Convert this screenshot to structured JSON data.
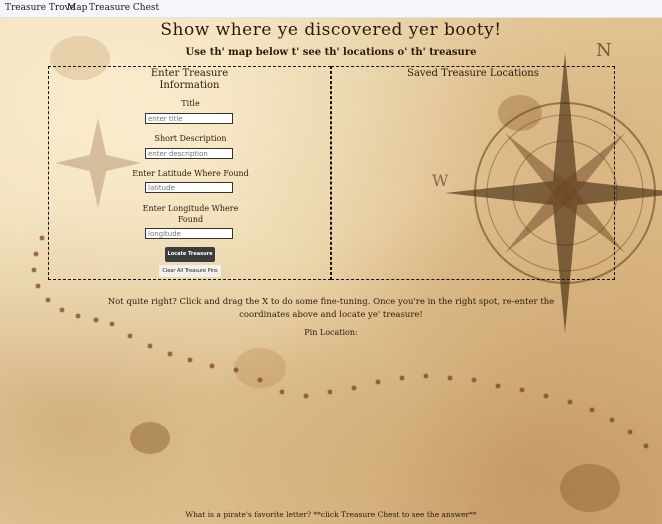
{
  "nav": {
    "brand": "Treasure Trove",
    "links": [
      "Map",
      "Treasure Chest"
    ]
  },
  "header": {
    "title": "Show where ye discovered yer booty!",
    "subtitle": "Use th' map below t' see th' locations o' th' treasure"
  },
  "form": {
    "heading": "Enter Treasure Information",
    "title_label": "Title",
    "title_placeholder": "enter title",
    "desc_label": "Short Description",
    "desc_placeholder": "enter description",
    "lat_label": "Enter Latitude Where Found",
    "lat_placeholder": "latitude",
    "lng_label": "Enter Longitude Where Found",
    "lng_placeholder": "longitude",
    "locate_button": "Locate Treasure",
    "clear_button": "Clear All Treasure Pins"
  },
  "saved": {
    "heading": "Saved Treasure Locations"
  },
  "help": {
    "text": "Not quite right? Click and drag the X to do some fine-tuning. Once you're in the right spot, re-enter the coordinates above and locate ye' treasure!",
    "pin_label": "Pin Location:"
  },
  "footer": {
    "text": "What is a pirate's favorite letter? **click Treasure Chest to see the answer**"
  },
  "colors": {
    "nav_bg": "#f4f6f9",
    "parchment": "#e9d3a6",
    "ink": "#2a1a0b",
    "button_dark": "#3c3c3c"
  },
  "icons": [
    "compass-rose-icon",
    "map-path-dots"
  ]
}
